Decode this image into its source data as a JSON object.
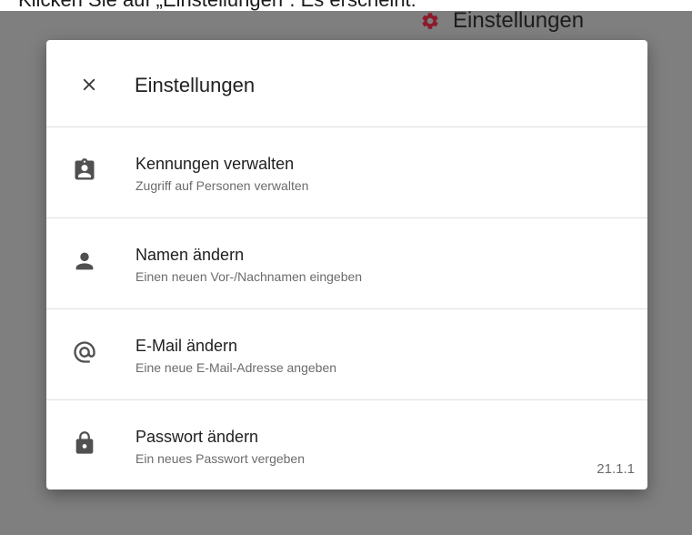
{
  "page": {
    "caption": "Klicken Sie auf „Einstellungen“. Es erscheint:",
    "background_header_label": "Einstellungen"
  },
  "dialog": {
    "title": "Einstellungen",
    "close_icon": "close-icon",
    "items": [
      {
        "icon": "badge-icon",
        "title": "Kennungen verwalten",
        "subtitle": "Zugriff auf Personen verwalten"
      },
      {
        "icon": "person-icon",
        "title": "Namen ändern",
        "subtitle": "Einen neuen Vor-/Nachnamen eingeben"
      },
      {
        "icon": "at-icon",
        "title": "E-Mail ändern",
        "subtitle": "Eine neue E-Mail-Adresse angeben"
      },
      {
        "icon": "lock-icon",
        "title": "Passwort ändern",
        "subtitle": "Ein neues Passwort vergeben"
      }
    ],
    "version": "21.1.1"
  },
  "colors": {
    "overlay": "#7f7f7f",
    "gear_accent": "#8b1a2b",
    "icon": "#505050"
  }
}
